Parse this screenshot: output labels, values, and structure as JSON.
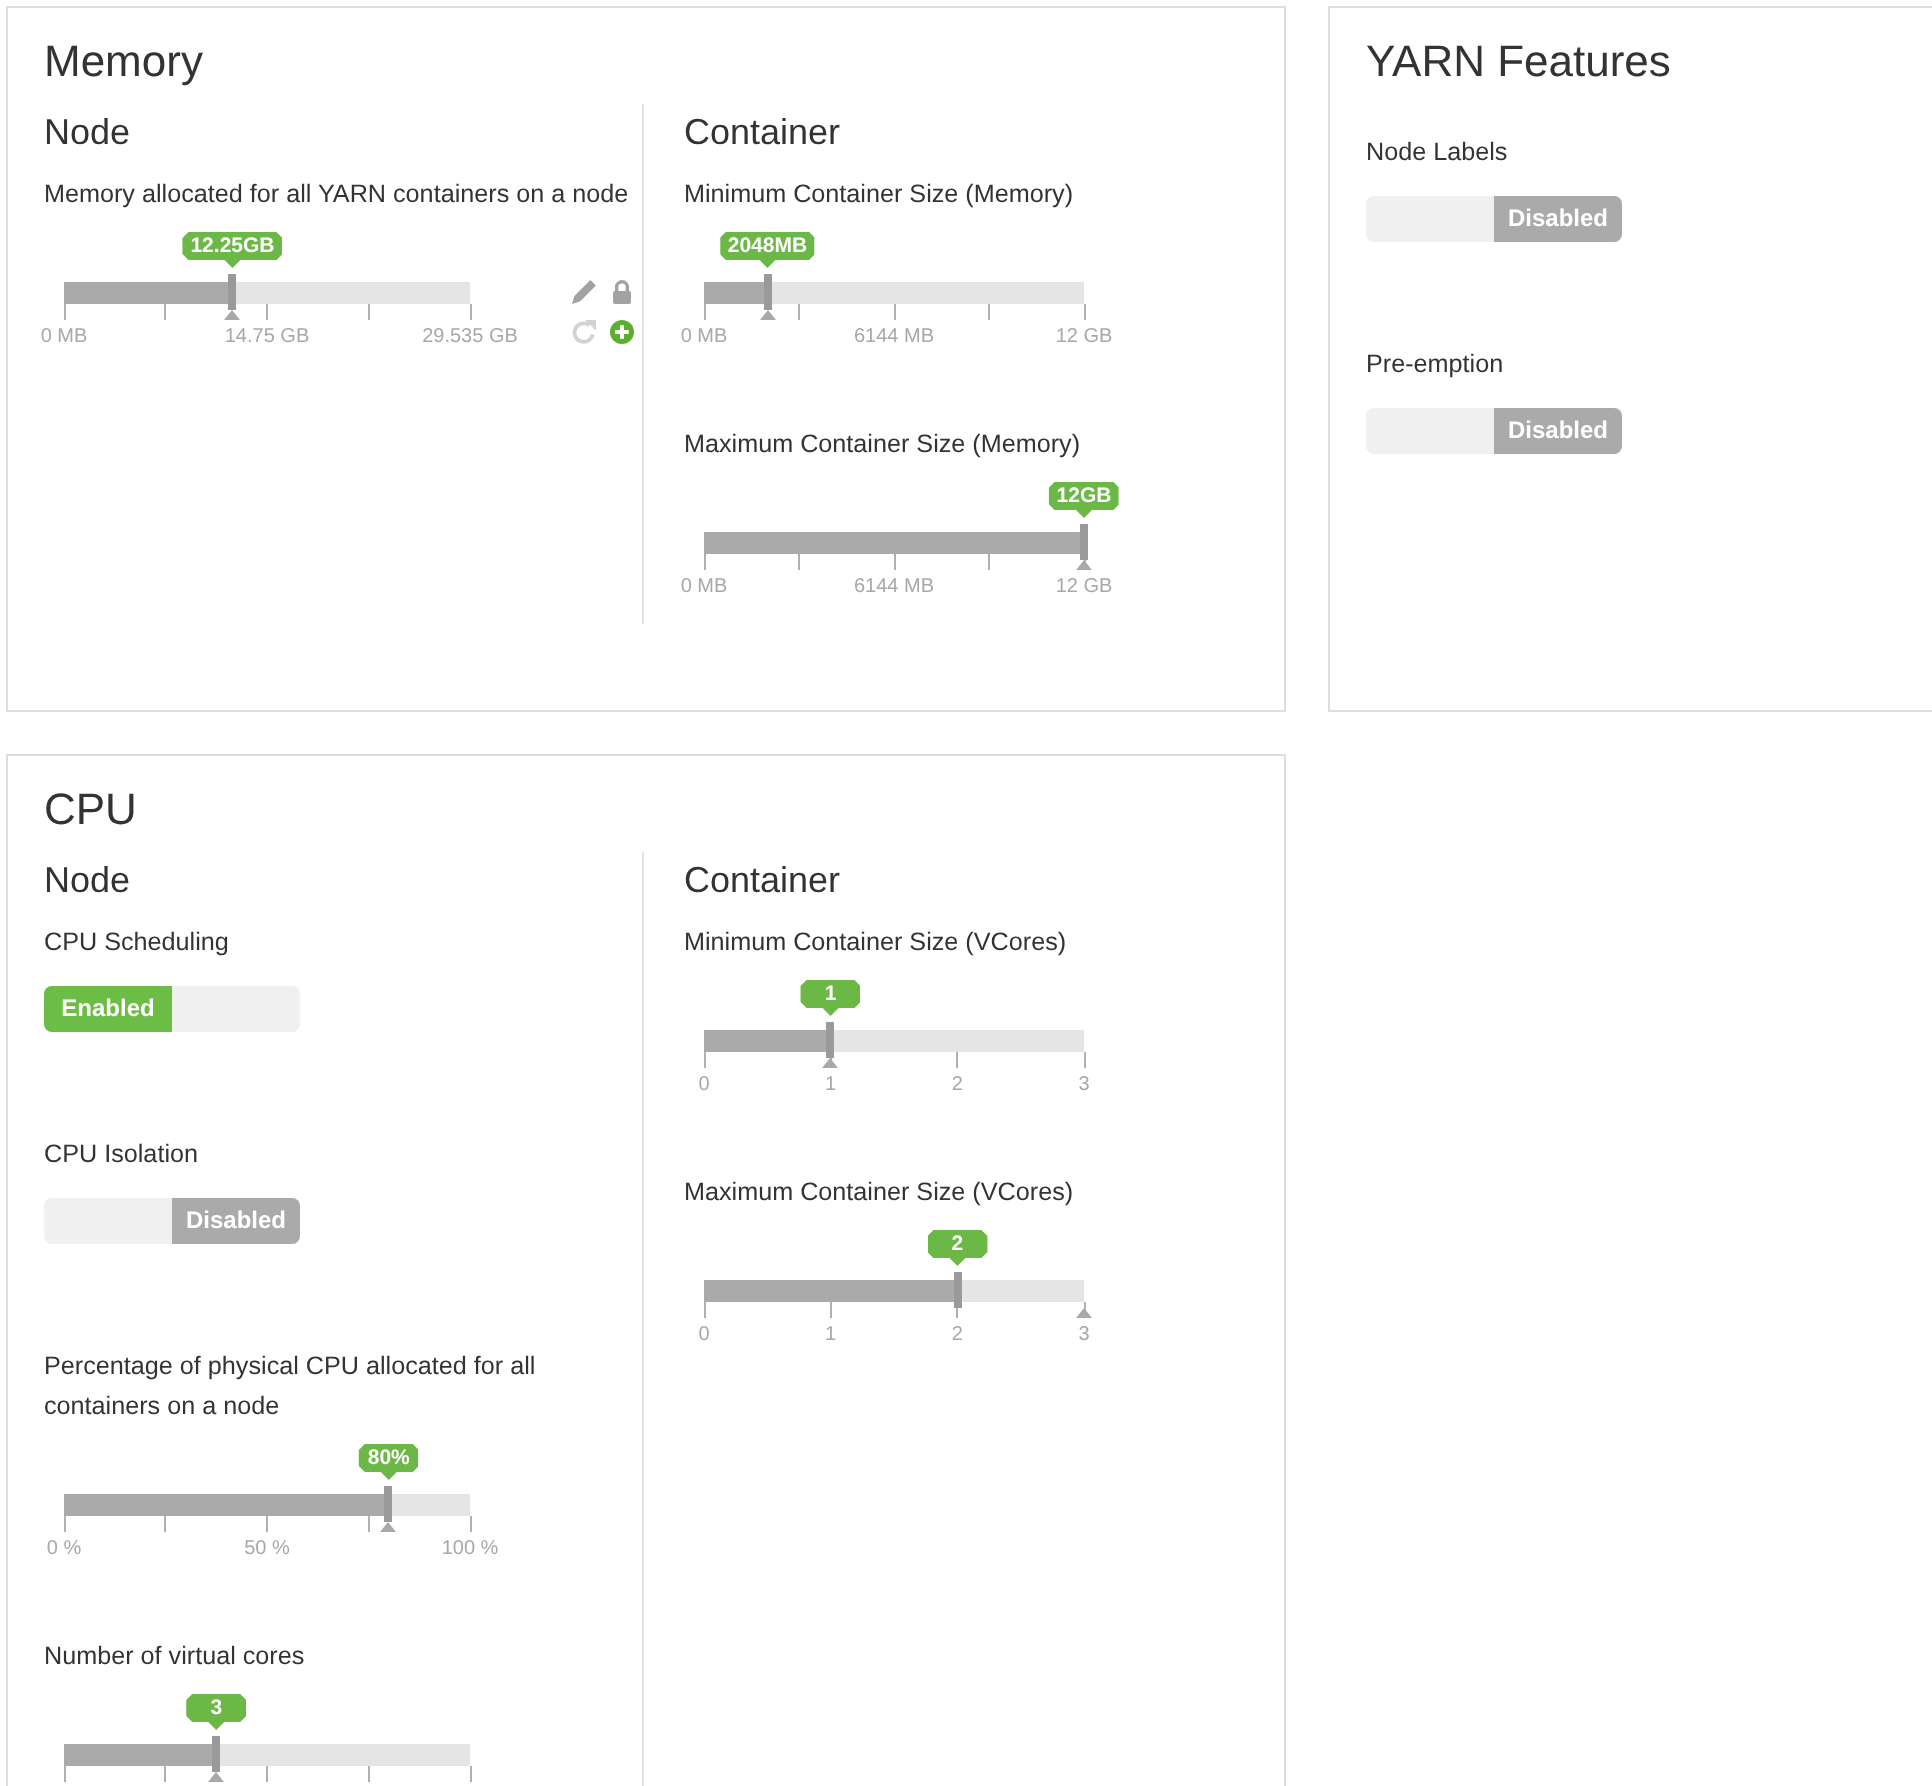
{
  "panels": [
    {
      "title": "Memory",
      "columns": [
        {
          "heading": "Node",
          "fields": [
            {
              "kind": "slider",
              "label": "Memory allocated for all YARN containers on a node",
              "value": "12.25GB",
              "level": 0.415,
              "at_recommended": true,
              "quarter_ticks": true,
              "scale_labels": [
                {
                  "text": "0 MB",
                  "recommended": false
                },
                {
                  "text": "14.75 GB",
                  "recommended": false
                },
                {
                  "text": "29.535 GB",
                  "recommended": false
                }
              ],
              "actions": [
                {
                  "kind": "edit",
                  "disabled": false
                },
                {
                  "kind": "lock",
                  "disabled": false
                },
                {
                  "kind": "refresh",
                  "disabled": true
                },
                {
                  "kind": "add",
                  "disabled": false
                }
              ]
            }
          ]
        },
        {
          "heading": "Container",
          "fields": [
            {
              "kind": "slider",
              "label": "Minimum Container Size (Memory)",
              "value": "2048MB",
              "level": 0.167,
              "at_recommended": true,
              "quarter_ticks": true,
              "scale_labels": [
                {
                  "text": "0 MB",
                  "recommended": false
                },
                {
                  "text": "6144 MB",
                  "recommended": false
                },
                {
                  "text": "12 GB",
                  "recommended": false
                }
              ]
            },
            {
              "kind": "slider",
              "label": "Maximum Container Size (Memory)",
              "value": "12GB",
              "level": 1,
              "at_recommended": true,
              "quarter_ticks": true,
              "scale_labels": [
                {
                  "text": "0 MB",
                  "recommended": false
                },
                {
                  "text": "6144 MB",
                  "recommended": false
                },
                {
                  "text": "12 GB",
                  "recommended": false
                }
              ]
            }
          ]
        }
      ]
    },
    {
      "title": "YARN Features",
      "fields": [
        {
          "kind": "toggle",
          "label": "Node Labels",
          "state_text": "Disabled",
          "on": false
        },
        {
          "kind": "toggle",
          "label": "Pre-emption",
          "state_text": "Disabled",
          "on": false
        }
      ]
    },
    {
      "title": "CPU",
      "columns": [
        {
          "heading": "Node",
          "fields": [
            {
              "kind": "toggle",
              "label": "CPU Scheduling",
              "state_text": "Enabled",
              "on": true
            },
            {
              "kind": "toggle",
              "label": "CPU Isolation",
              "state_text": "Disabled",
              "on": false
            },
            {
              "kind": "slider",
              "label": "Percentage of physical CPU allocated for all containers on a node",
              "value": "80%",
              "level": 0.8,
              "at_recommended": true,
              "quarter_ticks": true,
              "scale_labels": [
                {
                  "text": "0 %",
                  "recommended": false
                },
                {
                  "text": "50 %",
                  "recommended": false
                },
                {
                  "text": "100 %",
                  "recommended": false
                }
              ]
            },
            {
              "kind": "slider",
              "label": "Number of virtual cores",
              "value": "3",
              "level": 0.375,
              "at_recommended": true,
              "quarter_ticks": true
            }
          ]
        },
        {
          "heading": "Container",
          "fields": [
            {
              "kind": "slider",
              "label": "Minimum Container Size (VCores)",
              "value": "1",
              "level": 0.333,
              "at_recommended": true,
              "quarter_ticks": false,
              "scale_labels": [
                {
                  "text": "0",
                  "recommended": false
                },
                {
                  "text": "1",
                  "recommended": false
                },
                {
                  "text": "2",
                  "recommended": false
                },
                {
                  "text": "3",
                  "recommended": false
                }
              ]
            },
            {
              "kind": "slider",
              "label": "Maximum Container Size (VCores)",
              "value": "2",
              "level": 0.667,
              "at_recommended": false,
              "quarter_ticks": false,
              "scale_labels": [
                {
                  "text": "0",
                  "recommended": false
                },
                {
                  "text": "1",
                  "recommended": false
                },
                {
                  "text": "2",
                  "recommended": false
                },
                {
                  "text": "3",
                  "recommended": true
                }
              ]
            }
          ]
        }
      ]
    }
  ]
}
